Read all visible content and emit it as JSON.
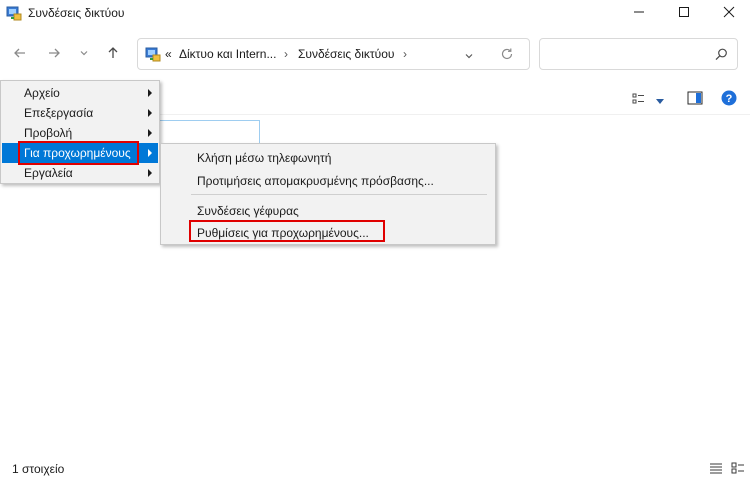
{
  "window": {
    "title": "Συνδέσεις δικτύου"
  },
  "address": {
    "prefix": "«",
    "crumbs": [
      "Δίκτυο και Intern...",
      "Συνδέσεις δικτύου"
    ],
    "separator": "›"
  },
  "search": {
    "placeholder": ""
  },
  "menu": {
    "items": [
      {
        "label": "Αρχείο"
      },
      {
        "label": "Επεξεργασία"
      },
      {
        "label": "Προβολή"
      },
      {
        "label": "Για προχωρημένους",
        "selected": true
      },
      {
        "label": "Εργαλεία"
      }
    ]
  },
  "submenu": {
    "items": [
      {
        "label": "Κλήση μέσω τηλεφωνητή"
      },
      {
        "label": "Προτιμήσεις απομακρυσμένης πρόσβασης..."
      },
      {
        "label": "Συνδέσεις γέφυρας"
      },
      {
        "label": "Ρυθμίσεις για προχωρημένους..."
      }
    ]
  },
  "status": {
    "item_count": "1 στοιχείο"
  },
  "colors": {
    "selection": "#0078d7",
    "highlight_box": "#e00000",
    "help_icon": "#1e6fd9"
  },
  "icons": [
    "network-folder-icon",
    "minimize-icon",
    "maximize-icon",
    "close-icon",
    "back-arrow-icon",
    "forward-arrow-icon",
    "chevron-down-icon",
    "up-arrow-icon",
    "refresh-icon",
    "search-icon",
    "view-options-icon",
    "preview-pane-icon",
    "help-icon",
    "details-view-icon",
    "tiles-view-icon"
  ]
}
